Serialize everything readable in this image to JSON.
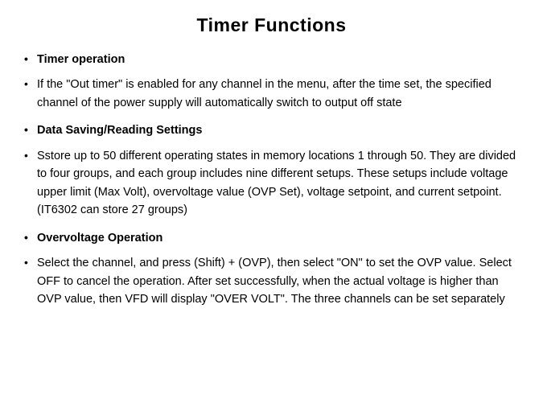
{
  "title": "Timer Functions",
  "sections": [
    {
      "heading": "Timer operation",
      "body": "If the \"Out timer\" is enabled for any channel in the menu, after the time set, the specified channel of the power supply will automatically switch to output off state"
    },
    {
      "heading": "Data Saving/Reading Settings",
      "body": "Sstore up to 50 different operating states in memory locations 1 through 50. They are divided to four groups, and each group includes nine different setups. These setups include voltage upper limit (Max Volt), overvoltage value (OVP Set), voltage setpoint, and current setpoint. (IT6302 can store 27 groups)"
    },
    {
      "heading": "Overvoltage Operation",
      "body": "Select the channel, and press (Shift) + (OVP), then select \"ON\" to set the OVP value. Select OFF to cancel the operation. After set successfully, when the actual voltage is higher than OVP value, then VFD will display \"OVER VOLT\". The three channels can be set separately"
    }
  ]
}
